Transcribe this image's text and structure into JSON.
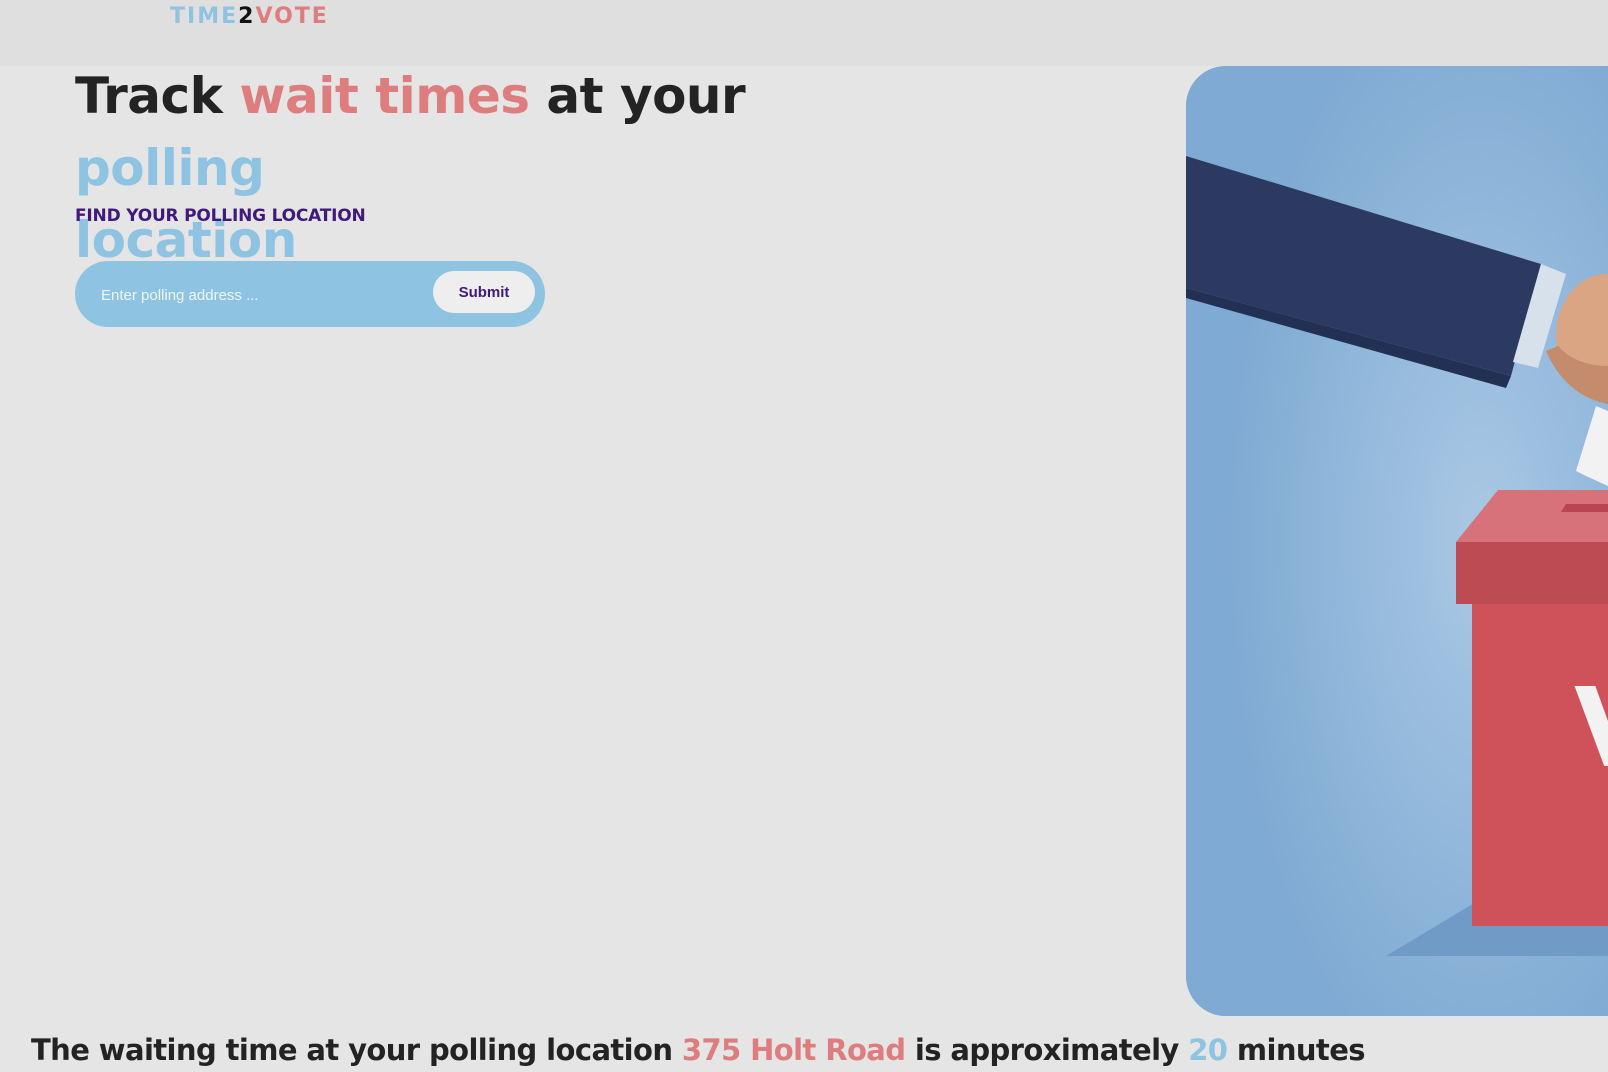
{
  "logo": {
    "part1": "TIME",
    "part2": "2",
    "part3": "VOTE"
  },
  "hero": {
    "headline": {
      "w1": "Track ",
      "w2": "wait times",
      "w3": " at your ",
      "w4": "polling",
      "w5": "location"
    },
    "find_label": "FIND YOUR POLLING LOCATION"
  },
  "search": {
    "placeholder": "Enter polling address ...",
    "value": "",
    "submit_label": "Submit"
  },
  "result": {
    "prefix": "The waiting time at your polling location ",
    "address": "375 Holt Road",
    "middle": " is approximately ",
    "minutes": "20",
    "suffix": " minutes"
  },
  "colors": {
    "page_bg": "#e5e5e5",
    "topbar_bg": "#dfdfdf",
    "accent_blue": "#8fc3e2",
    "accent_red": "#dd7d7d",
    "accent_purple": "#3f1a7a",
    "text_dark": "#232323",
    "illustration_bg": "#80abd4",
    "suit_navy": "#2c3a61",
    "ballot_box_red": "#cf525a"
  },
  "illustration": {
    "subject": "hand-casting-ballot-illustration",
    "box_letter": "V"
  }
}
